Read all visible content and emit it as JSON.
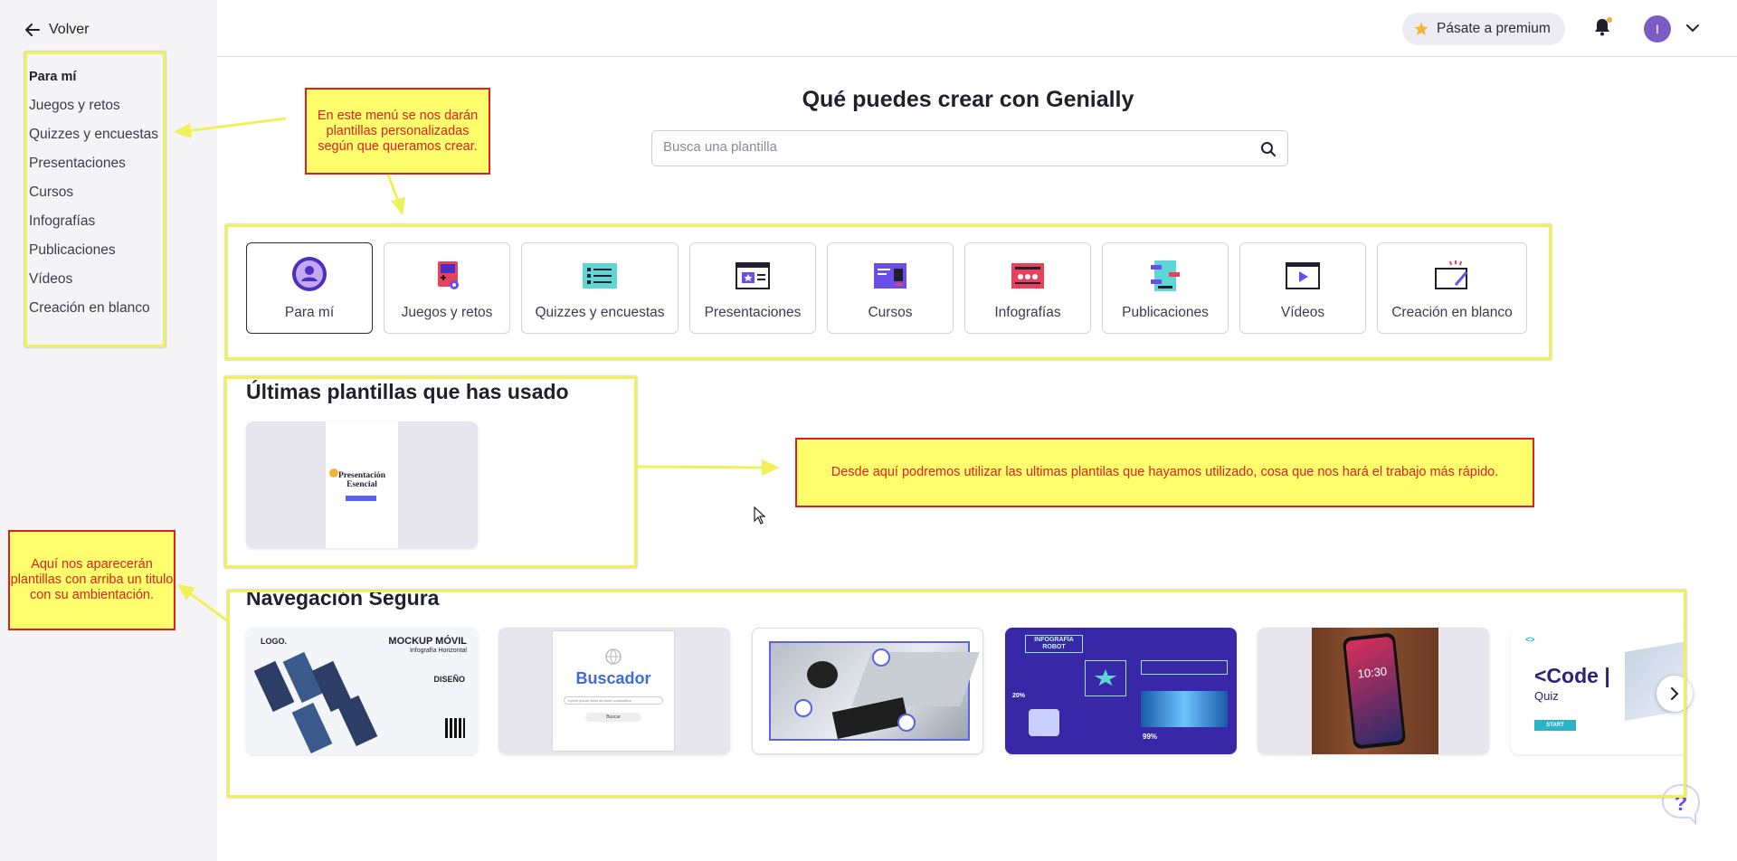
{
  "sidebar": {
    "back_label": "Volver",
    "items": [
      {
        "label": "Para mí",
        "active": true
      },
      {
        "label": "Juegos y retos"
      },
      {
        "label": "Quizzes y encuestas"
      },
      {
        "label": "Presentaciones"
      },
      {
        "label": "Cursos"
      },
      {
        "label": "Infografías"
      },
      {
        "label": "Publicaciones"
      },
      {
        "label": "Vídeos"
      },
      {
        "label": "Creación en blanco"
      }
    ]
  },
  "topbar": {
    "premium_label": "Pásate a premium",
    "avatar_initial": "I",
    "accent": "#7c5cc4"
  },
  "main": {
    "title": "Qué puedes crear con Genially",
    "search_placeholder": "Busca una plantilla",
    "categories": [
      {
        "label": "Para mí",
        "icon": "user-icon"
      },
      {
        "label": "Juegos y retos",
        "icon": "game-icon"
      },
      {
        "label": "Quizzes y encuestas",
        "icon": "quiz-list-icon"
      },
      {
        "label": "Presentaciones",
        "icon": "presentation-icon"
      },
      {
        "label": "Cursos",
        "icon": "course-icon"
      },
      {
        "label": "Infografías",
        "icon": "infographic-icon"
      },
      {
        "label": "Publicaciones",
        "icon": "publication-icon"
      },
      {
        "label": "Vídeos",
        "icon": "video-icon"
      },
      {
        "label": "Creación en blanco",
        "icon": "blank-canvas-icon"
      }
    ],
    "recent_title": "Últimas plantillas que has usado",
    "recent_template": {
      "title_line1": "Presentación",
      "title_line2": "Esencial"
    },
    "safe_title": "Navegación Segura",
    "safe_templates": {
      "mockup": {
        "logo": "LOGO.",
        "title": "MOCKUP MÓVIL",
        "subtitle": "Infografía Horizontal",
        "section": "DISEÑO"
      },
      "search": {
        "title": "Buscador",
        "input": "Lorem ipsum dolor sit amet consectetur",
        "button": "Buscar"
      },
      "robot": {
        "title": "INFOGRAFÍA ROBOT",
        "percent_a": "20%",
        "percent_b": "99%"
      },
      "phone": {
        "time": "10:30"
      },
      "code": {
        "tag": "<>",
        "title": "<Code |",
        "subtitle": "Quiz",
        "button": "START"
      }
    }
  },
  "annotations": {
    "menu_note": "En este menú se nos darán plantillas personalizadas según que queramos crear.",
    "recent_note": "Desde aquí podremos utilizar las ultimas plantilas que hayamos utilizado, cosa que nos hará el trabajo más rápido.",
    "title_note": "Aquí nos aparecerán plantillas con arriba un titulo con su ambientación.",
    "highlight_color": "#f0f05a",
    "note_bg": "#ffff6e",
    "note_text_color": "#e0201c"
  }
}
